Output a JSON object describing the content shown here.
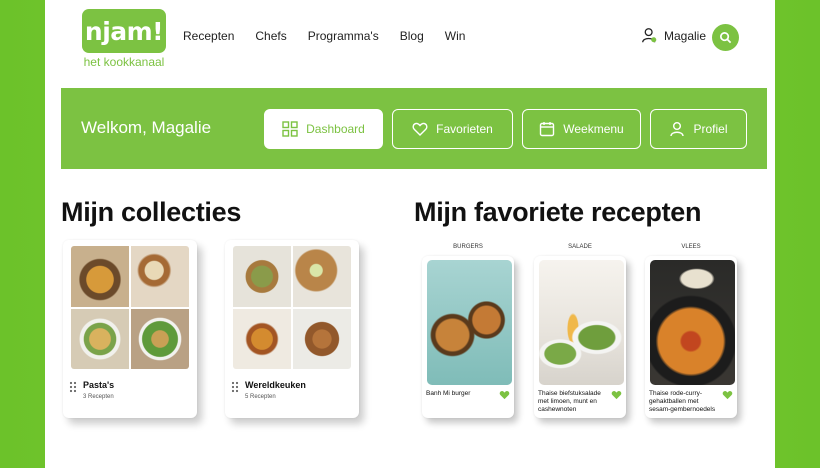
{
  "logo": {
    "text": "njam!",
    "tagline": "het kookkanaal"
  },
  "nav": [
    "Recepten",
    "Chefs",
    "Programma's",
    "Blog",
    "Win"
  ],
  "user": {
    "name": "Magalie"
  },
  "welcome": "Welkom, Magalie",
  "tabs": [
    {
      "label": "Dashboard",
      "icon": "grid-icon",
      "active": true
    },
    {
      "label": "Favorieten",
      "icon": "heart-icon",
      "active": false
    },
    {
      "label": "Weekmenu",
      "icon": "calendar-icon",
      "active": false
    },
    {
      "label": "Profiel",
      "icon": "user-icon",
      "active": false
    }
  ],
  "collections": {
    "title": "Mijn collecties",
    "items": [
      {
        "label": "Pasta's",
        "count": "3 Recepten"
      },
      {
        "label": "Wereldkeuken",
        "count": "5 Recepten"
      }
    ]
  },
  "favorites": {
    "title": "Mijn favoriete recepten",
    "items": [
      {
        "tag": "BURGERS",
        "title": "Banh Mi burger"
      },
      {
        "tag": "SALADE",
        "title": "Thaise biefstuksalade met limoen, munt en cashewnoten"
      },
      {
        "tag": "VLEES",
        "title": "Thaise rode-curry-gehaktballen met sesam-gembernoedels"
      }
    ]
  },
  "colors": {
    "brand": "#7cc242",
    "text": "#111111"
  }
}
